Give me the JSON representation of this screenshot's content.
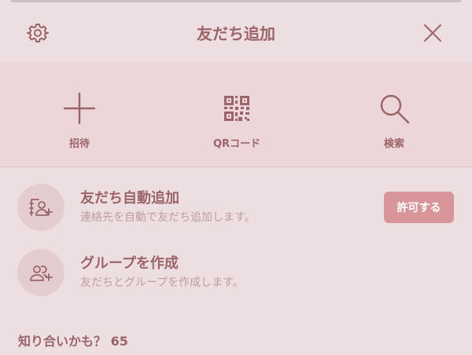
{
  "header": {
    "title": "友だち追加",
    "settings_icon": "gear-icon",
    "close_icon": "close-icon"
  },
  "actions": [
    {
      "label": "招待",
      "icon": "plus-icon"
    },
    {
      "label": "QRコード",
      "icon": "qr-code-icon"
    },
    {
      "label": "検索",
      "icon": "search-icon"
    }
  ],
  "rows": [
    {
      "title": "友だち自動追加",
      "subtitle": "連絡先を自動で友だち追加します。",
      "icon": "contact-add-icon",
      "button": "許可する"
    },
    {
      "title": "グループを作成",
      "subtitle": "友だちとグループを作成します。",
      "icon": "group-add-icon"
    }
  ],
  "suggestions": {
    "label": "知り合いかも？",
    "count": "65"
  },
  "colors": {
    "background": "#eddfe1",
    "action_band": "#ecd6d9",
    "text": "#9c6469",
    "accent_button": "#d8969b"
  }
}
